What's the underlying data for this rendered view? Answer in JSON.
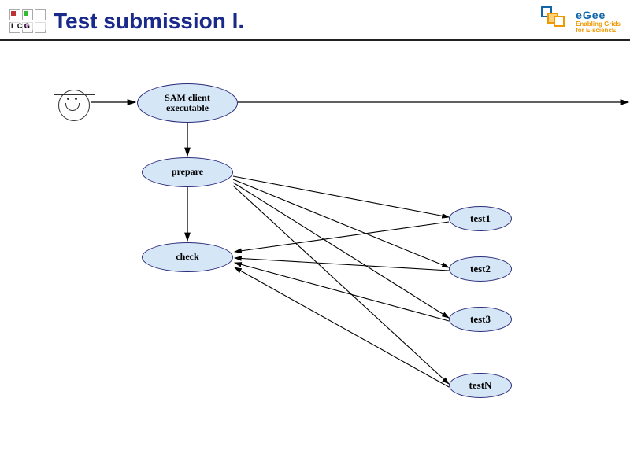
{
  "header": {
    "lcg_label": "L C G",
    "title": "Test submission I.",
    "egee_big": "eGee",
    "egee_line1": "Enabling Grids",
    "egee_line2": "for E-sciencE"
  },
  "nodes": {
    "sam_client": "SAM client\nexecutable",
    "prepare": "prepare",
    "check": "check",
    "test1": "test1",
    "test2": "test2",
    "test3": "test3",
    "testN": "testN"
  },
  "colors": {
    "node_fill": "#d5e6f7",
    "node_border": "#2a2a7a",
    "title": "#1a2a8a"
  }
}
